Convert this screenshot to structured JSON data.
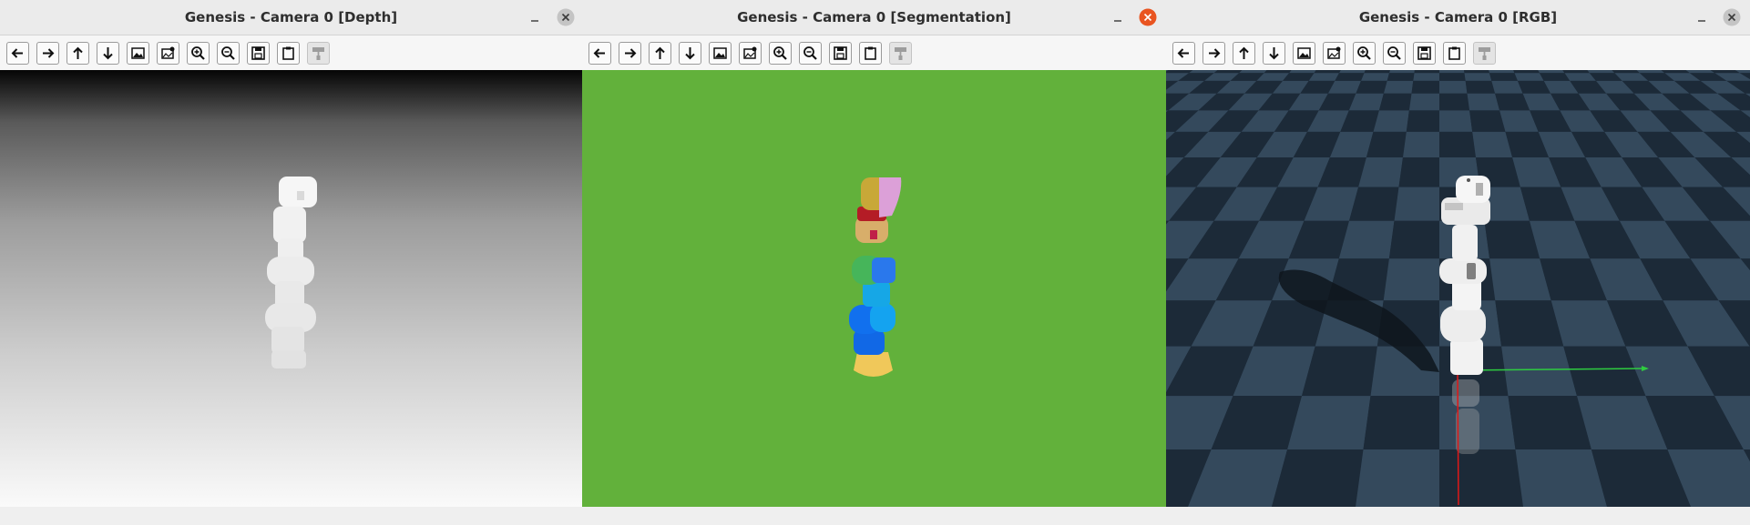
{
  "windows": [
    {
      "id": "depth",
      "title": "Genesis - Camera 0 [Depth]",
      "close_style": "grey"
    },
    {
      "id": "segmentation",
      "title": "Genesis - Camera 0 [Segmentation]",
      "close_style": "orange"
    },
    {
      "id": "rgb",
      "title": "Genesis - Camera 0 [RGB]",
      "close_style": "grey"
    }
  ],
  "toolbar_icons": [
    "back-arrow-icon",
    "forward-arrow-icon",
    "up-arrow-icon",
    "down-arrow-icon",
    "image-icon",
    "image-settings-icon",
    "zoom-in-icon",
    "zoom-out-icon",
    "save-icon",
    "clipboard-icon",
    "paint-roller-icon"
  ],
  "colors": {
    "segmentation_background": "#62b13b",
    "close_active": "#e95420",
    "close_inactive": "#bfbfbf",
    "floor_dark": "#1c2a38",
    "floor_light": "#34495c"
  }
}
